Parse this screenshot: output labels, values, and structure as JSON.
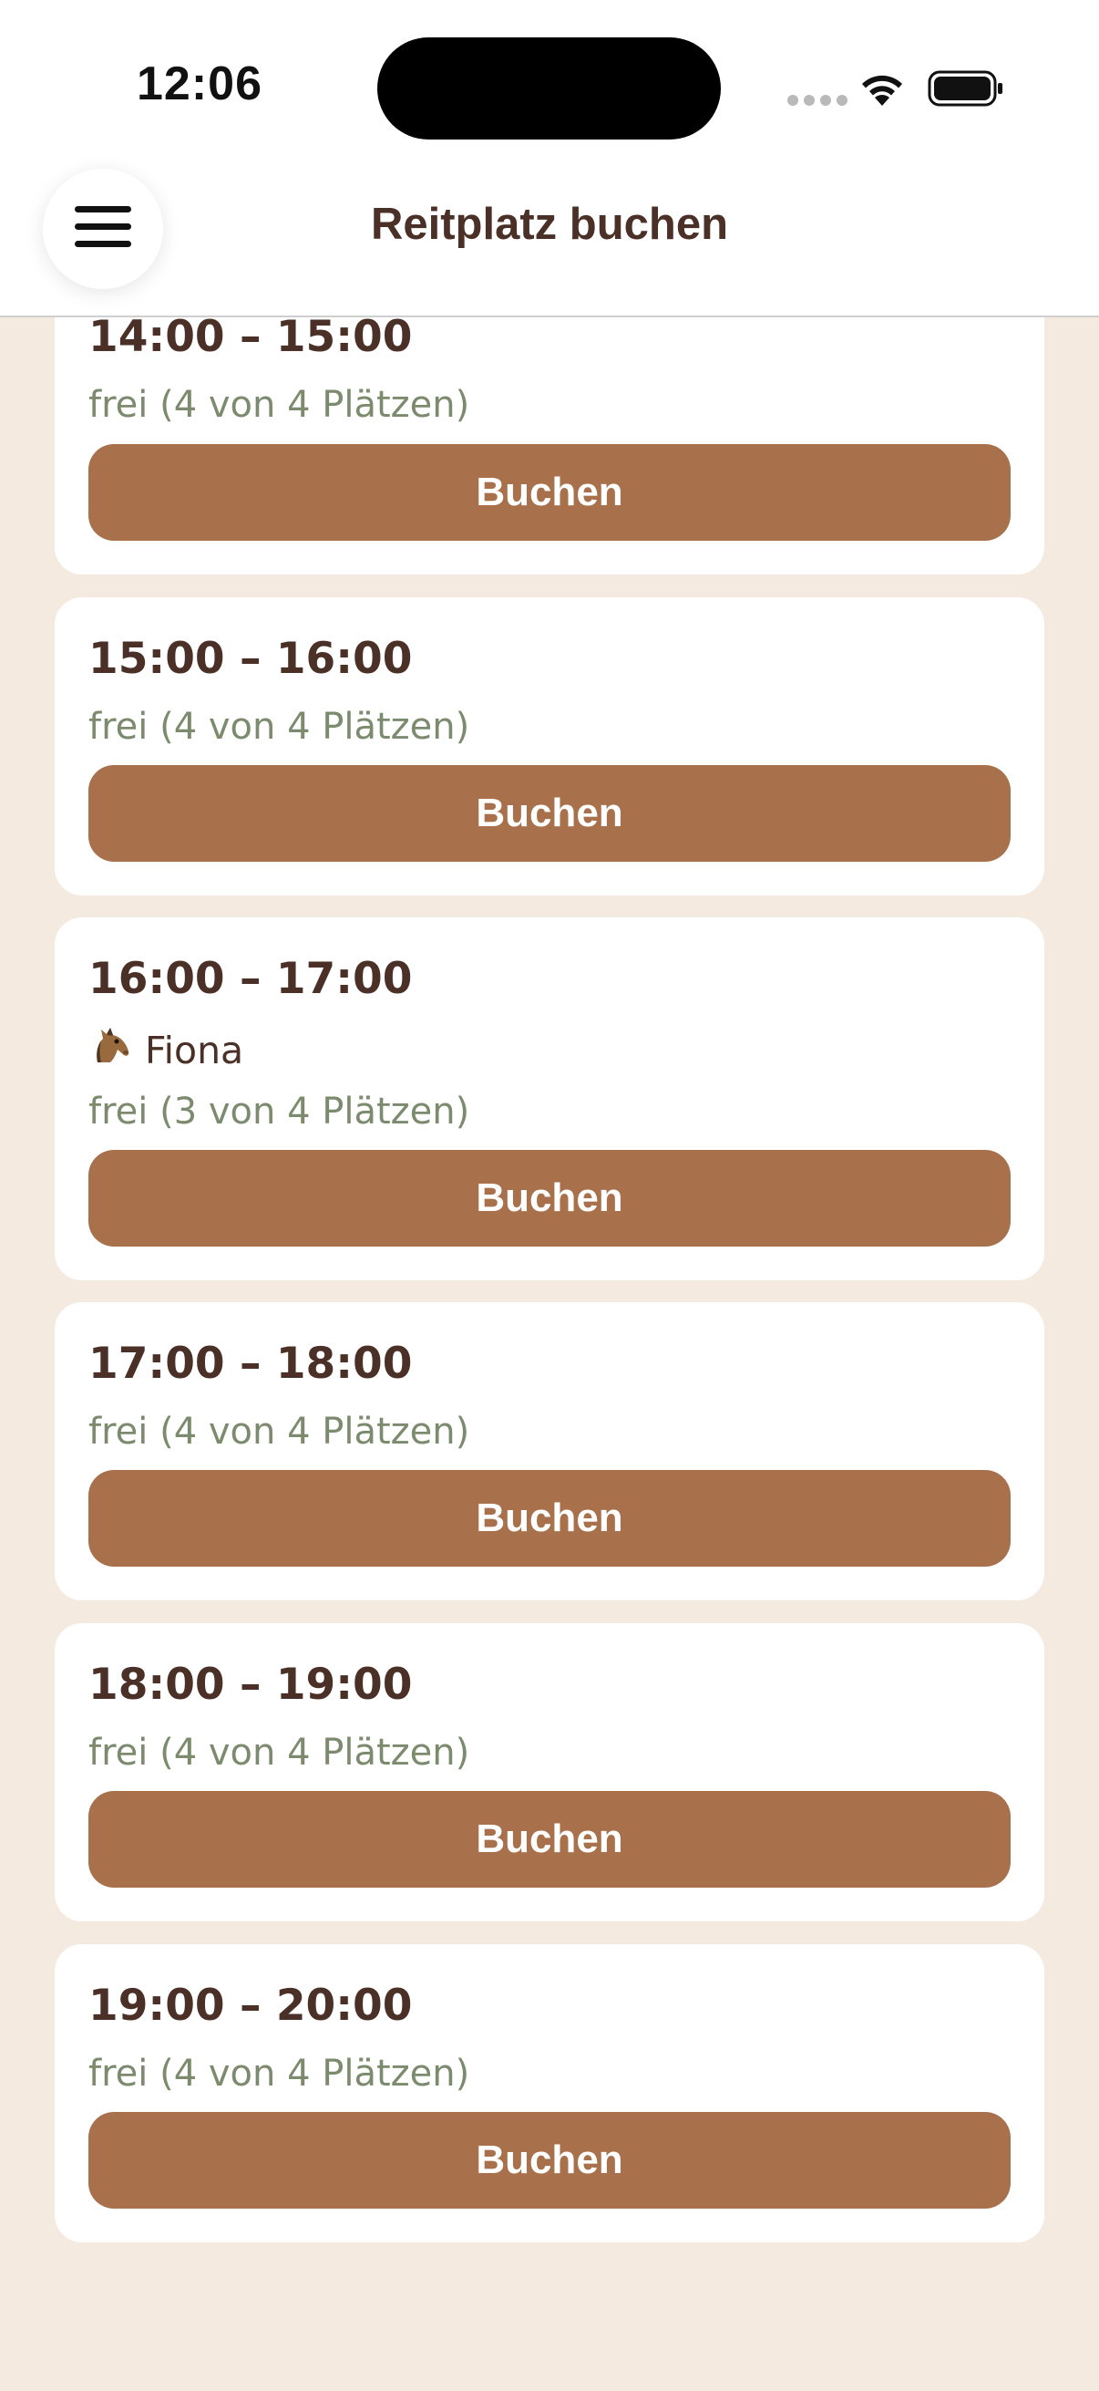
{
  "status_bar": {
    "time": "12:06",
    "icons": [
      "cellular-signal-icon",
      "wifi-icon",
      "battery-icon"
    ]
  },
  "header": {
    "title": "Reitplatz buchen",
    "menu_icon": "hamburger-menu-icon"
  },
  "colors": {
    "background": "#f4eadf",
    "card": "#ffffff",
    "accent_button": "#a8714c",
    "title_text": "#4a3026",
    "status_text": "#7c8b6d"
  },
  "slots": [
    {
      "time": "14:00 – 15:00",
      "status": "frei (4 von 4 Plätzen)",
      "button": "Buchen"
    },
    {
      "time": "15:00 – 16:00",
      "status": "frei (4 von 4 Plätzen)",
      "button": "Buchen"
    },
    {
      "time": "16:00 – 17:00",
      "horse_icon": "horse-icon",
      "horse": "Fiona",
      "status": "frei (3 von 4 Plätzen)",
      "button": "Buchen"
    },
    {
      "time": "17:00 – 18:00",
      "status": "frei (4 von 4 Plätzen)",
      "button": "Buchen"
    },
    {
      "time": "18:00 – 19:00",
      "status": "frei (4 von 4 Plätzen)",
      "button": "Buchen"
    },
    {
      "time": "19:00 – 20:00",
      "status": "frei (4 von 4 Plätzen)",
      "button": "Buchen"
    }
  ]
}
